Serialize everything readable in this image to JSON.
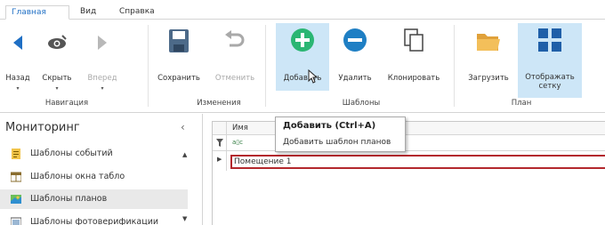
{
  "tabs": {
    "main": "Главная",
    "view": "Вид",
    "help": "Справка"
  },
  "ribbon": {
    "back": "Назад",
    "hide": "Скрыть",
    "forward": "Вперед",
    "save": "Сохранить",
    "undo": "Отменить",
    "add": "Добавить",
    "delete": "Удалить",
    "clone": "Клонировать",
    "load": "Загрузить",
    "show_grid_line1": "Отображать",
    "show_grid_line2": "сетку",
    "group_navigation": "Навигация",
    "group_changes": "Изменения",
    "group_templates": "Шаблоны",
    "group_plan": "План"
  },
  "nav": {
    "title": "Мониторинг",
    "items": [
      "Шаблоны событий",
      "Шаблоны окна табло",
      "Шаблоны планов",
      "Шаблоны фотоверификации"
    ]
  },
  "grid": {
    "col_name": "Имя",
    "filter_glyph": "a▯c",
    "rows": [
      "Помещение 1"
    ]
  },
  "tooltip": {
    "title": "Добавить (Ctrl+A)",
    "desc": "Добавить шаблон планов"
  },
  "colors": {
    "accent": "#1f6fc4",
    "add_green": "#2bb673",
    "delete_blue": "#1f7fc4",
    "highlight": "#cde6f7",
    "selection_border": "#b3282d"
  }
}
